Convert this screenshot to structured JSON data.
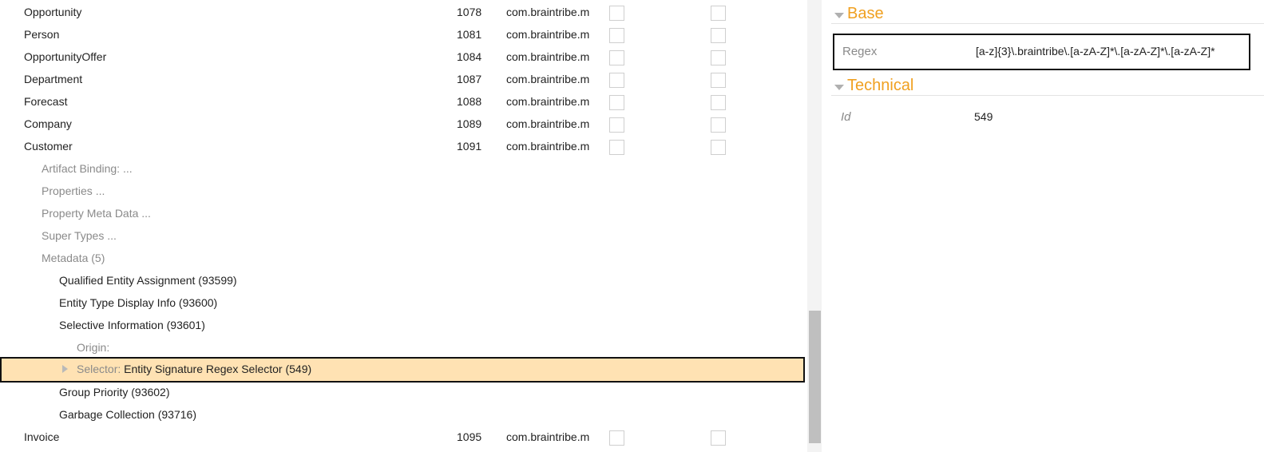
{
  "tree": {
    "entities": [
      {
        "name": "Opportunity",
        "id": "1078",
        "package": "com.braintribe.m"
      },
      {
        "name": "Person",
        "id": "1081",
        "package": "com.braintribe.m"
      },
      {
        "name": "OpportunityOffer",
        "id": "1084",
        "package": "com.braintribe.m"
      },
      {
        "name": "Department",
        "id": "1087",
        "package": "com.braintribe.m"
      },
      {
        "name": "Forecast",
        "id": "1088",
        "package": "com.braintribe.m"
      },
      {
        "name": "Company",
        "id": "1089",
        "package": "com.braintribe.m"
      },
      {
        "name": "Customer",
        "id": "1091",
        "package": "com.braintribe.m"
      }
    ],
    "customer_children": [
      {
        "label": "Artifact Binding: ..."
      },
      {
        "label": "Properties ..."
      },
      {
        "label": "Property Meta Data ..."
      },
      {
        "label": "Super Types ..."
      },
      {
        "label": "Metadata (5)"
      }
    ],
    "metadata_items": [
      {
        "label": "Qualified Entity Assignment (93599)"
      },
      {
        "label": "Entity Type Display Info (93600)"
      },
      {
        "label": "Selective Information (93601)"
      }
    ],
    "origin_label": "Origin:",
    "selector": {
      "label": "Selector:",
      "value": "Entity Signature Regex Selector (549)"
    },
    "metadata_items_after": [
      {
        "label": "Group Priority (93602)"
      },
      {
        "label": "Garbage Collection (93716)"
      }
    ],
    "last_entity": {
      "name": "Invoice",
      "id": "1095",
      "package": "com.braintribe.m"
    }
  },
  "properties": {
    "groups": [
      {
        "title": "Base",
        "rows": [
          {
            "label": "Regex",
            "value": "[a-z]{3}\\.braintribe\\.[a-zA-Z]*\\.[a-zA-Z]*\\.[a-zA-Z]*"
          }
        ]
      },
      {
        "title": "Technical",
        "rows": [
          {
            "label": "Id",
            "value": "549"
          }
        ]
      }
    ]
  },
  "colors": {
    "accent": "#f0a020",
    "selected_row": "#ffe2b3",
    "muted_text": "#8a8a8a"
  }
}
